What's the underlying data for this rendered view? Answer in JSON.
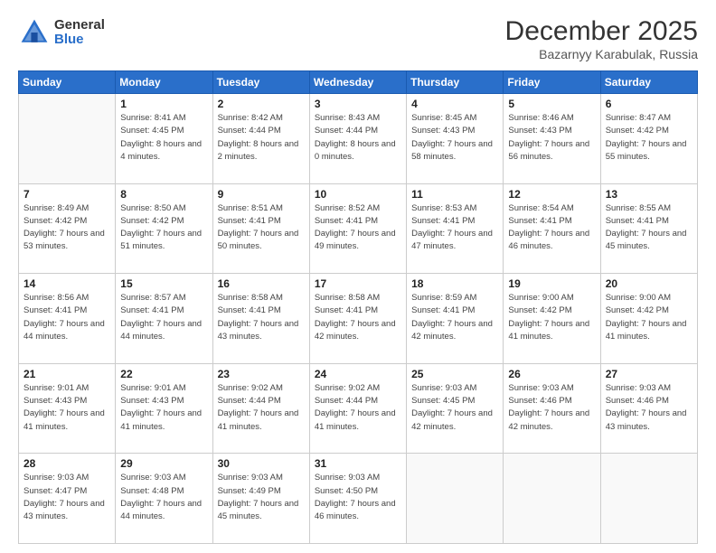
{
  "logo": {
    "general": "General",
    "blue": "Blue"
  },
  "header": {
    "month": "December 2025",
    "location": "Bazarnyy Karabulak, Russia"
  },
  "weekdays": [
    "Sunday",
    "Monday",
    "Tuesday",
    "Wednesday",
    "Thursday",
    "Friday",
    "Saturday"
  ],
  "weeks": [
    [
      {
        "day": "",
        "sunrise": "",
        "sunset": "",
        "daylight": ""
      },
      {
        "day": "1",
        "sunrise": "Sunrise: 8:41 AM",
        "sunset": "Sunset: 4:45 PM",
        "daylight": "Daylight: 8 hours and 4 minutes."
      },
      {
        "day": "2",
        "sunrise": "Sunrise: 8:42 AM",
        "sunset": "Sunset: 4:44 PM",
        "daylight": "Daylight: 8 hours and 2 minutes."
      },
      {
        "day": "3",
        "sunrise": "Sunrise: 8:43 AM",
        "sunset": "Sunset: 4:44 PM",
        "daylight": "Daylight: 8 hours and 0 minutes."
      },
      {
        "day": "4",
        "sunrise": "Sunrise: 8:45 AM",
        "sunset": "Sunset: 4:43 PM",
        "daylight": "Daylight: 7 hours and 58 minutes."
      },
      {
        "day": "5",
        "sunrise": "Sunrise: 8:46 AM",
        "sunset": "Sunset: 4:43 PM",
        "daylight": "Daylight: 7 hours and 56 minutes."
      },
      {
        "day": "6",
        "sunrise": "Sunrise: 8:47 AM",
        "sunset": "Sunset: 4:42 PM",
        "daylight": "Daylight: 7 hours and 55 minutes."
      }
    ],
    [
      {
        "day": "7",
        "sunrise": "Sunrise: 8:49 AM",
        "sunset": "Sunset: 4:42 PM",
        "daylight": "Daylight: 7 hours and 53 minutes."
      },
      {
        "day": "8",
        "sunrise": "Sunrise: 8:50 AM",
        "sunset": "Sunset: 4:42 PM",
        "daylight": "Daylight: 7 hours and 51 minutes."
      },
      {
        "day": "9",
        "sunrise": "Sunrise: 8:51 AM",
        "sunset": "Sunset: 4:41 PM",
        "daylight": "Daylight: 7 hours and 50 minutes."
      },
      {
        "day": "10",
        "sunrise": "Sunrise: 8:52 AM",
        "sunset": "Sunset: 4:41 PM",
        "daylight": "Daylight: 7 hours and 49 minutes."
      },
      {
        "day": "11",
        "sunrise": "Sunrise: 8:53 AM",
        "sunset": "Sunset: 4:41 PM",
        "daylight": "Daylight: 7 hours and 47 minutes."
      },
      {
        "day": "12",
        "sunrise": "Sunrise: 8:54 AM",
        "sunset": "Sunset: 4:41 PM",
        "daylight": "Daylight: 7 hours and 46 minutes."
      },
      {
        "day": "13",
        "sunrise": "Sunrise: 8:55 AM",
        "sunset": "Sunset: 4:41 PM",
        "daylight": "Daylight: 7 hours and 45 minutes."
      }
    ],
    [
      {
        "day": "14",
        "sunrise": "Sunrise: 8:56 AM",
        "sunset": "Sunset: 4:41 PM",
        "daylight": "Daylight: 7 hours and 44 minutes."
      },
      {
        "day": "15",
        "sunrise": "Sunrise: 8:57 AM",
        "sunset": "Sunset: 4:41 PM",
        "daylight": "Daylight: 7 hours and 44 minutes."
      },
      {
        "day": "16",
        "sunrise": "Sunrise: 8:58 AM",
        "sunset": "Sunset: 4:41 PM",
        "daylight": "Daylight: 7 hours and 43 minutes."
      },
      {
        "day": "17",
        "sunrise": "Sunrise: 8:58 AM",
        "sunset": "Sunset: 4:41 PM",
        "daylight": "Daylight: 7 hours and 42 minutes."
      },
      {
        "day": "18",
        "sunrise": "Sunrise: 8:59 AM",
        "sunset": "Sunset: 4:41 PM",
        "daylight": "Daylight: 7 hours and 42 minutes."
      },
      {
        "day": "19",
        "sunrise": "Sunrise: 9:00 AM",
        "sunset": "Sunset: 4:42 PM",
        "daylight": "Daylight: 7 hours and 41 minutes."
      },
      {
        "day": "20",
        "sunrise": "Sunrise: 9:00 AM",
        "sunset": "Sunset: 4:42 PM",
        "daylight": "Daylight: 7 hours and 41 minutes."
      }
    ],
    [
      {
        "day": "21",
        "sunrise": "Sunrise: 9:01 AM",
        "sunset": "Sunset: 4:43 PM",
        "daylight": "Daylight: 7 hours and 41 minutes."
      },
      {
        "day": "22",
        "sunrise": "Sunrise: 9:01 AM",
        "sunset": "Sunset: 4:43 PM",
        "daylight": "Daylight: 7 hours and 41 minutes."
      },
      {
        "day": "23",
        "sunrise": "Sunrise: 9:02 AM",
        "sunset": "Sunset: 4:44 PM",
        "daylight": "Daylight: 7 hours and 41 minutes."
      },
      {
        "day": "24",
        "sunrise": "Sunrise: 9:02 AM",
        "sunset": "Sunset: 4:44 PM",
        "daylight": "Daylight: 7 hours and 41 minutes."
      },
      {
        "day": "25",
        "sunrise": "Sunrise: 9:03 AM",
        "sunset": "Sunset: 4:45 PM",
        "daylight": "Daylight: 7 hours and 42 minutes."
      },
      {
        "day": "26",
        "sunrise": "Sunrise: 9:03 AM",
        "sunset": "Sunset: 4:46 PM",
        "daylight": "Daylight: 7 hours and 42 minutes."
      },
      {
        "day": "27",
        "sunrise": "Sunrise: 9:03 AM",
        "sunset": "Sunset: 4:46 PM",
        "daylight": "Daylight: 7 hours and 43 minutes."
      }
    ],
    [
      {
        "day": "28",
        "sunrise": "Sunrise: 9:03 AM",
        "sunset": "Sunset: 4:47 PM",
        "daylight": "Daylight: 7 hours and 43 minutes."
      },
      {
        "day": "29",
        "sunrise": "Sunrise: 9:03 AM",
        "sunset": "Sunset: 4:48 PM",
        "daylight": "Daylight: 7 hours and 44 minutes."
      },
      {
        "day": "30",
        "sunrise": "Sunrise: 9:03 AM",
        "sunset": "Sunset: 4:49 PM",
        "daylight": "Daylight: 7 hours and 45 minutes."
      },
      {
        "day": "31",
        "sunrise": "Sunrise: 9:03 AM",
        "sunset": "Sunset: 4:50 PM",
        "daylight": "Daylight: 7 hours and 46 minutes."
      },
      {
        "day": "",
        "sunrise": "",
        "sunset": "",
        "daylight": ""
      },
      {
        "day": "",
        "sunrise": "",
        "sunset": "",
        "daylight": ""
      },
      {
        "day": "",
        "sunrise": "",
        "sunset": "",
        "daylight": ""
      }
    ]
  ]
}
